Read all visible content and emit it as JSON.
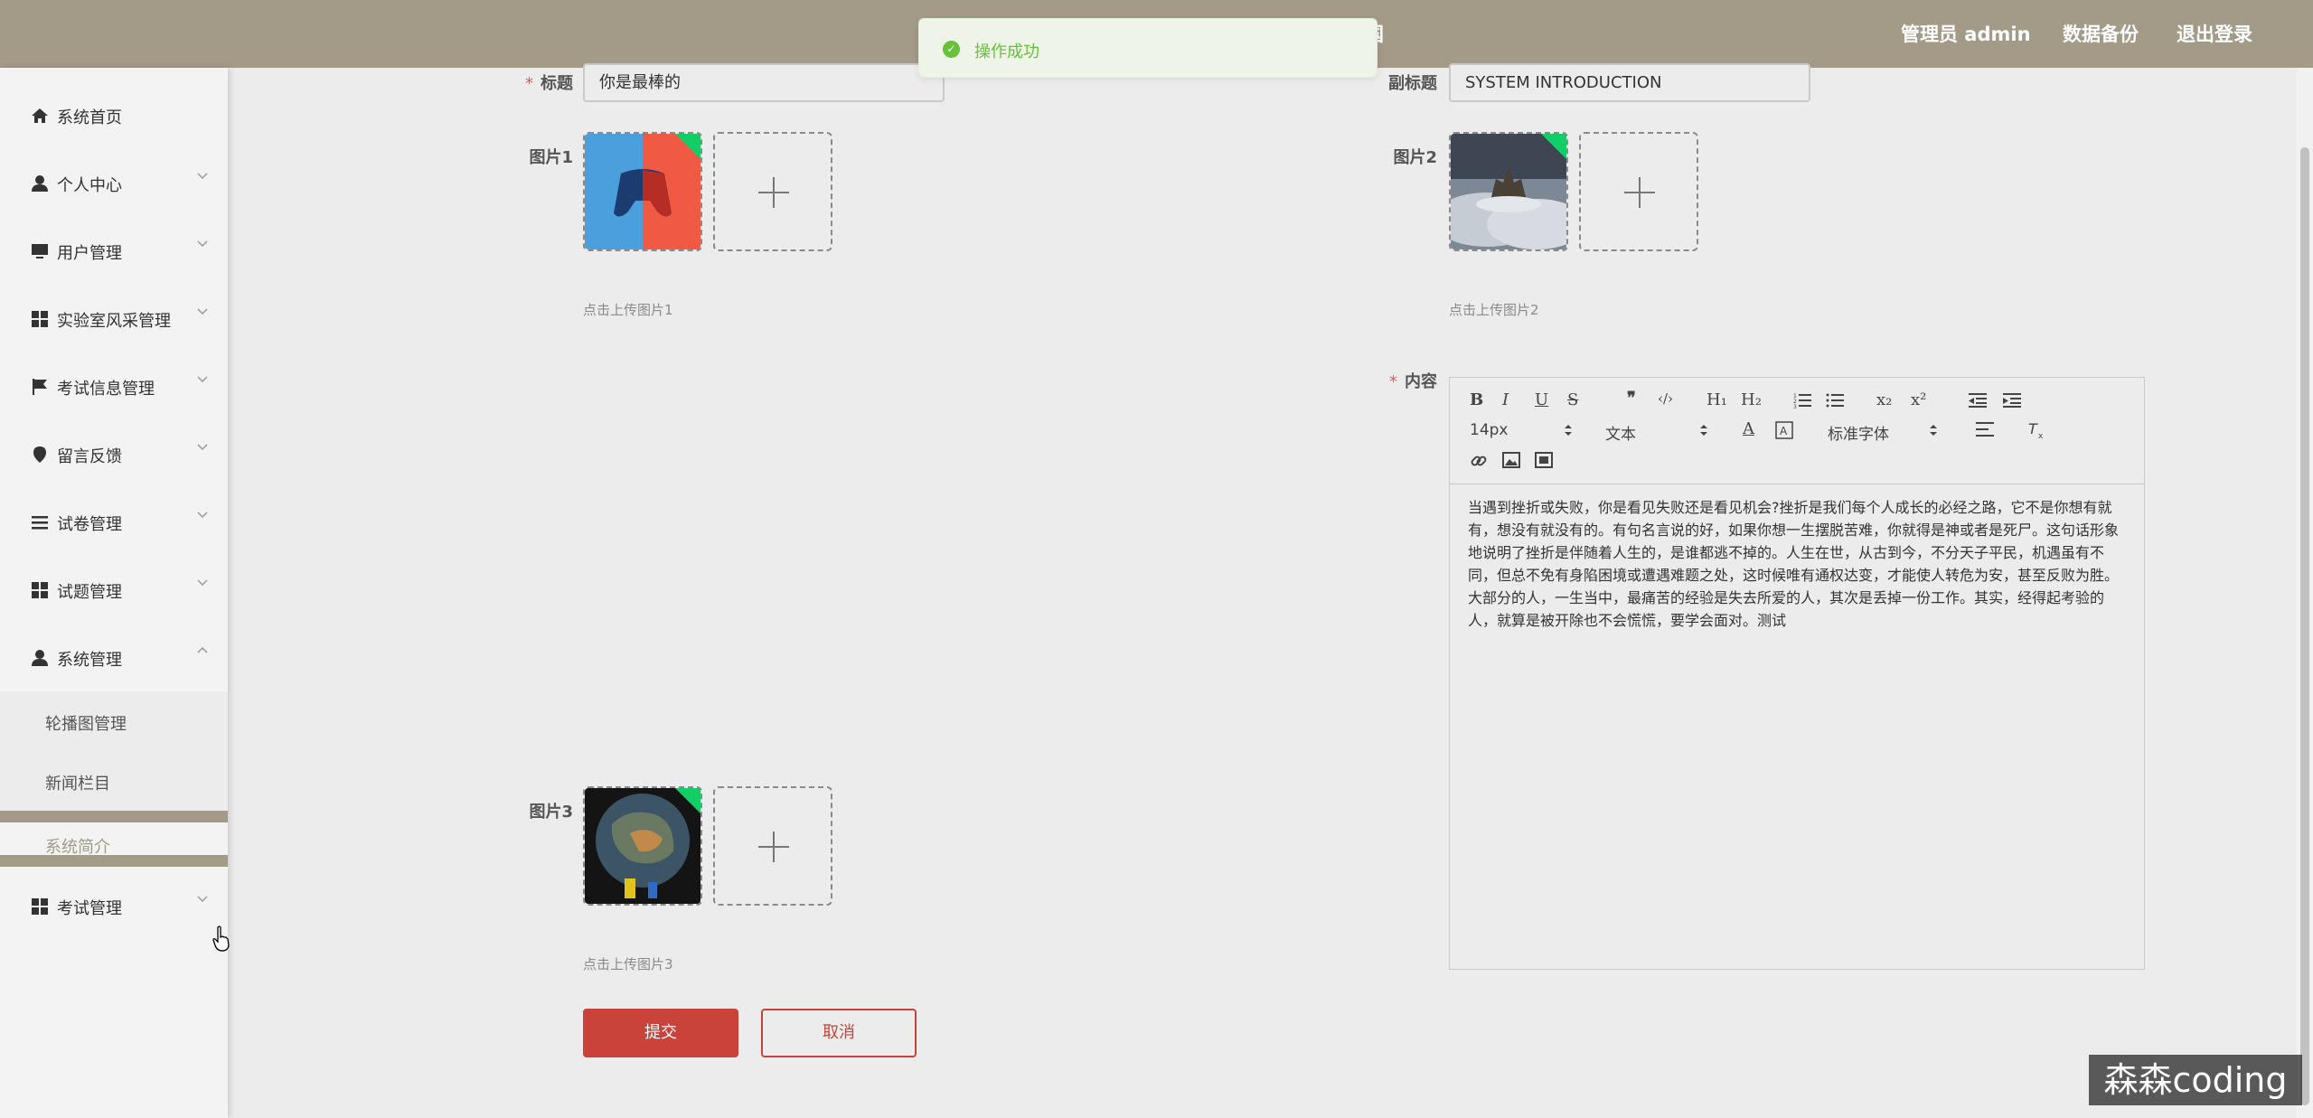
{
  "header": {
    "title_fragment": "国",
    "admin_label": "管理员 admin",
    "backup_label": "数据备份",
    "logout_label": "退出登录"
  },
  "toast": {
    "text": "操作成功",
    "color": "#67c23a"
  },
  "sidebar": {
    "items": [
      {
        "label": "系统首页",
        "icon": "home-icon"
      },
      {
        "label": "个人中心",
        "icon": "user-icon"
      },
      {
        "label": "用户管理",
        "icon": "monitor-icon"
      },
      {
        "label": "实验室风采管理",
        "icon": "grid-icon"
      },
      {
        "label": "考试信息管理",
        "icon": "flag-icon"
      },
      {
        "label": "留言反馈",
        "icon": "location-icon"
      },
      {
        "label": "试卷管理",
        "icon": "list-icon"
      },
      {
        "label": "试题管理",
        "icon": "grid-icon"
      },
      {
        "label": "系统管理",
        "icon": "user-icon"
      },
      {
        "label": "考试管理",
        "icon": "grid-icon"
      }
    ],
    "submenu": [
      {
        "label": "轮播图管理"
      },
      {
        "label": "新闻栏目"
      },
      {
        "label": "系统简介"
      }
    ]
  },
  "form": {
    "title_label": "标题",
    "title_value": "你是最棒的",
    "subtitle_label": "副标题",
    "subtitle_value": "SYSTEM INTRODUCTION",
    "image1_label": "图片1",
    "image1_hint": "点击上传图片1",
    "image2_label": "图片2",
    "image2_hint": "点击上传图片2",
    "image3_label": "图片3",
    "image3_hint": "点击上传图片3",
    "content_label": "内容",
    "required_mark": "*",
    "submit_label": "提交",
    "cancel_label": "取消"
  },
  "editor": {
    "toolbar": {
      "bold": "B",
      "italic": "I",
      "underline": "U",
      "strike": "S",
      "quote": "❞",
      "code": "‹/›",
      "h1": "H₁",
      "h2": "H₂",
      "subscript": "x₂",
      "superscript": "x²",
      "font_size": "14px",
      "header_select": "文本",
      "font_family": "标准字体",
      "color": "A"
    },
    "content": "当遇到挫折或失败，你是看见失败还是看见机会?挫折是我们每个人成长的必经之路，它不是你想有就有，想没有就没有的。有句名言说的好，如果你想一生摆脱苦难，你就得是神或者是死尸。这句话形象地说明了挫折是伴随着人生的，是谁都逃不掉的。人生在世，从古到今，不分天子平民，机遇虽有不同，但总不免有身陷困境或遭遇难题之处，这时候唯有通权达变，才能使人转危为安，甚至反败为胜。大部分的人，一生当中，最痛苦的经验是失去所爱的人，其次是丢掉一份工作。其实，经得起考验的人，就算是被开除也不会慌慌，要学会面对。测试"
  },
  "watermark": "森森coding",
  "colors": {
    "header_bg": "#a39a88",
    "accent_red": "#c9433a",
    "success_green": "#67c23a",
    "corner_green": "#13ce66"
  }
}
